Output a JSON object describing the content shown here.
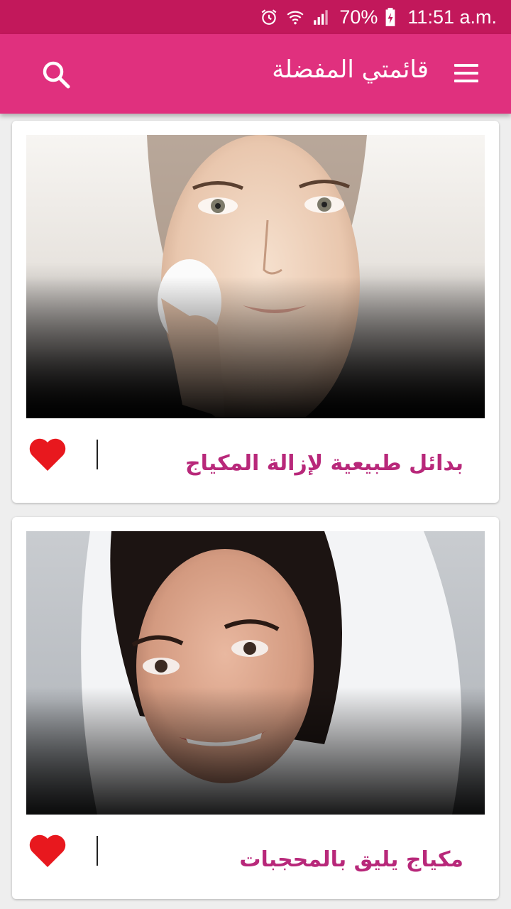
{
  "status_bar": {
    "battery_percent": "70%",
    "time": "11:51 a.m."
  },
  "app_bar": {
    "title": "قائمتي المفضلة",
    "menu_icon": "menu-icon",
    "search_icon": "search-icon"
  },
  "colors": {
    "status_bar": "#c2185b",
    "app_bar": "#e0307e",
    "title_text": "#b8287a",
    "heart": "#e8181e"
  },
  "articles": [
    {
      "title": "بدائل طبيعية لإزالة المكياج",
      "favorite": true,
      "image": "woman-removing-makeup-photo"
    },
    {
      "title": "مكياج يليق بالمحجبات",
      "favorite": true,
      "image": "woman-in-white-hijab-photo"
    }
  ]
}
